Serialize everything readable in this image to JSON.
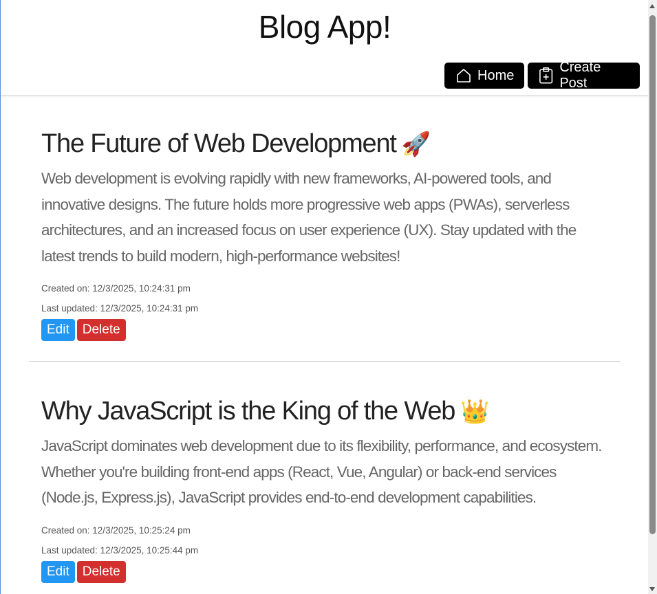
{
  "app": {
    "title": "Blog App!"
  },
  "nav": {
    "home_label": "Home",
    "create_label": "Create Post"
  },
  "posts": [
    {
      "title": "The Future of Web Development",
      "emoji": "🚀",
      "body": "Web development is evolving rapidly with new frameworks, AI-powered tools, and innovative designs. The future holds more progressive web apps (PWAs), serverless architectures, and an increased focus on user experience (UX). Stay updated with the latest trends to build modern, high-performance websites!",
      "created": "Created on: 12/3/2025, 10:24:31 pm",
      "updated": "Last updated: 12/3/2025, 10:24:31 pm",
      "edit_label": "Edit",
      "delete_label": "Delete"
    },
    {
      "title": "Why JavaScript is the King of the Web",
      "emoji": "👑",
      "body": "JavaScript dominates web development due to its flexibility, performance, and ecosystem. Whether you're building front-end apps (React, Vue, Angular) or back-end services (Node.js, Express.js), JavaScript provides end-to-end development capabilities.",
      "created": "Created on: 12/3/2025, 10:25:24 pm",
      "updated": "Last updated: 12/3/2025, 10:25:44 pm",
      "edit_label": "Edit",
      "delete_label": "Delete"
    }
  ],
  "colors": {
    "nav_bg": "#000000",
    "edit": "#2196f3",
    "delete": "#d32f2f"
  }
}
